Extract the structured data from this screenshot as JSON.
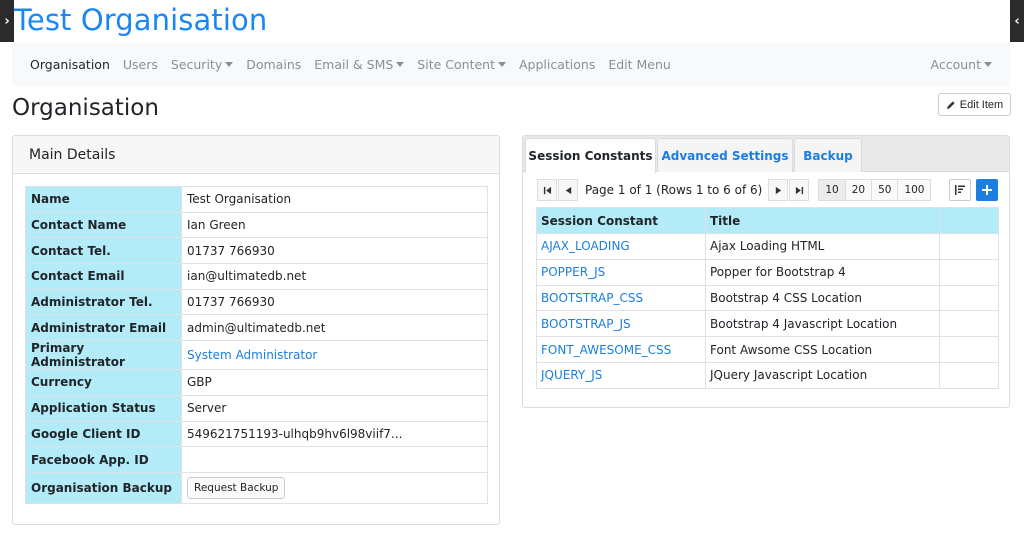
{
  "site": {
    "title": "Test Organisation"
  },
  "nav": {
    "items": [
      {
        "label": "Organisation",
        "active": true,
        "dropdown": false
      },
      {
        "label": "Users",
        "active": false,
        "dropdown": false
      },
      {
        "label": "Security",
        "active": false,
        "dropdown": true
      },
      {
        "label": "Domains",
        "active": false,
        "dropdown": false
      },
      {
        "label": "Email & SMS",
        "active": false,
        "dropdown": true
      },
      {
        "label": "Site Content",
        "active": false,
        "dropdown": true
      },
      {
        "label": "Applications",
        "active": false,
        "dropdown": false
      },
      {
        "label": "Edit Menu",
        "active": false,
        "dropdown": false
      }
    ],
    "account": "Account"
  },
  "page": {
    "title": "Organisation",
    "edit_label": "Edit Item"
  },
  "main_details": {
    "header": "Main Details",
    "rows": [
      {
        "label": "Name",
        "value": "Test Organisation"
      },
      {
        "label": "Contact Name",
        "value": "Ian Green"
      },
      {
        "label": "Contact Tel.",
        "value": "01737 766930"
      },
      {
        "label": "Contact Email",
        "value": "ian@ultimatedb.net"
      },
      {
        "label": "Administrator Tel.",
        "value": "01737 766930"
      },
      {
        "label": "Administrator Email",
        "value": "admin@ultimatedb.net"
      },
      {
        "label": "Primary Administrator",
        "value": "System Administrator"
      },
      {
        "label": "Currency",
        "value": "GBP"
      },
      {
        "label": "Application Status",
        "value": "Server"
      },
      {
        "label": "Google Client ID",
        "value": "549621751193-ulhqb9hv6l98viif7..."
      },
      {
        "label": "Facebook App. ID",
        "value": ""
      },
      {
        "label": "Organisation Backup",
        "value": "Request Backup"
      }
    ]
  },
  "tabs": [
    {
      "label": "Session Constants",
      "active": true
    },
    {
      "label": "Advanced Settings",
      "active": false
    },
    {
      "label": "Backup",
      "active": false
    }
  ],
  "pager": {
    "info": "Page 1 of 1 (Rows 1 to 6 of 6)",
    "sizes": [
      "10",
      "20",
      "50",
      "100"
    ],
    "selected_size": "10"
  },
  "grid": {
    "headers": [
      "Session Constant",
      "Title",
      ""
    ],
    "rows": [
      {
        "constant": "AJAX_LOADING",
        "title": "Ajax Loading HTML"
      },
      {
        "constant": "POPPER_JS",
        "title": "Popper for Bootstrap 4"
      },
      {
        "constant": "BOOTSTRAP_CSS",
        "title": "Bootstrap 4 CSS Location"
      },
      {
        "constant": "BOOTSTRAP_JS",
        "title": "Bootstrap 4 Javascript Location"
      },
      {
        "constant": "FONT_AWESOME_CSS",
        "title": "Font Awsome CSS Location"
      },
      {
        "constant": "JQUERY_JS",
        "title": "JQuery Javascript Location"
      }
    ]
  },
  "colors": {
    "brand": "#1b86f5",
    "link": "#1b7ee0",
    "label_bg": "#b3ecf8",
    "navbar_bg": "#f8f9fa"
  },
  "icons": {
    "sidebar_toggle": "chevron-right-icon",
    "edit": "pencil-icon",
    "sort": "sort-icon",
    "add": "plus-icon"
  }
}
